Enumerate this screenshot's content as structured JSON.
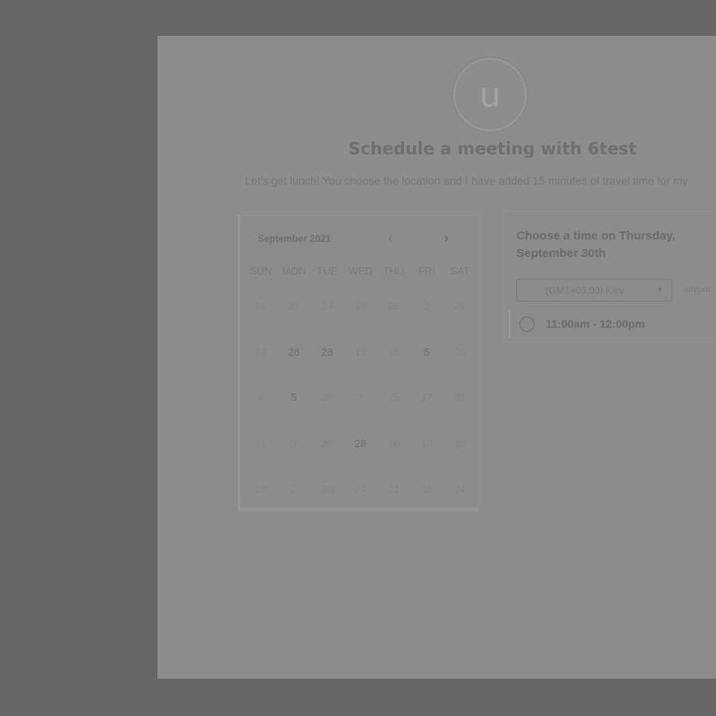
{
  "avatar": {
    "initial": "u"
  },
  "page": {
    "title": "Schedule a meeting with 6test",
    "description": "Let's get lunch! You choose the location and I have added 15 minutes of travel time for my"
  },
  "calendar": {
    "month_label": "September 2021",
    "prev_icon": "chevron-left-icon",
    "next_icon": "chevron-right-icon",
    "weekdays": [
      "SUN",
      "MON",
      "TUE",
      "WED",
      "THU",
      "FRI",
      "SAT"
    ],
    "days": [
      "29",
      "29",
      "24",
      "15",
      "25",
      "2",
      "29",
      "12",
      "28",
      "28",
      "13",
      "16",
      "5",
      "20",
      "6",
      "5",
      "26",
      "7",
      "15",
      "17",
      "31",
      "21",
      "18",
      "20",
      "28",
      "16",
      "10",
      "20",
      "18",
      "2",
      "20",
      "24",
      "21",
      "15",
      "24"
    ]
  },
  "times": {
    "heading": "Choose a time on Thursday, September 30th",
    "timezone": "(GMT+03:00) Kiev",
    "format_toggle": "am/pm",
    "slots": [
      "11:00am - 12:00pm"
    ]
  }
}
